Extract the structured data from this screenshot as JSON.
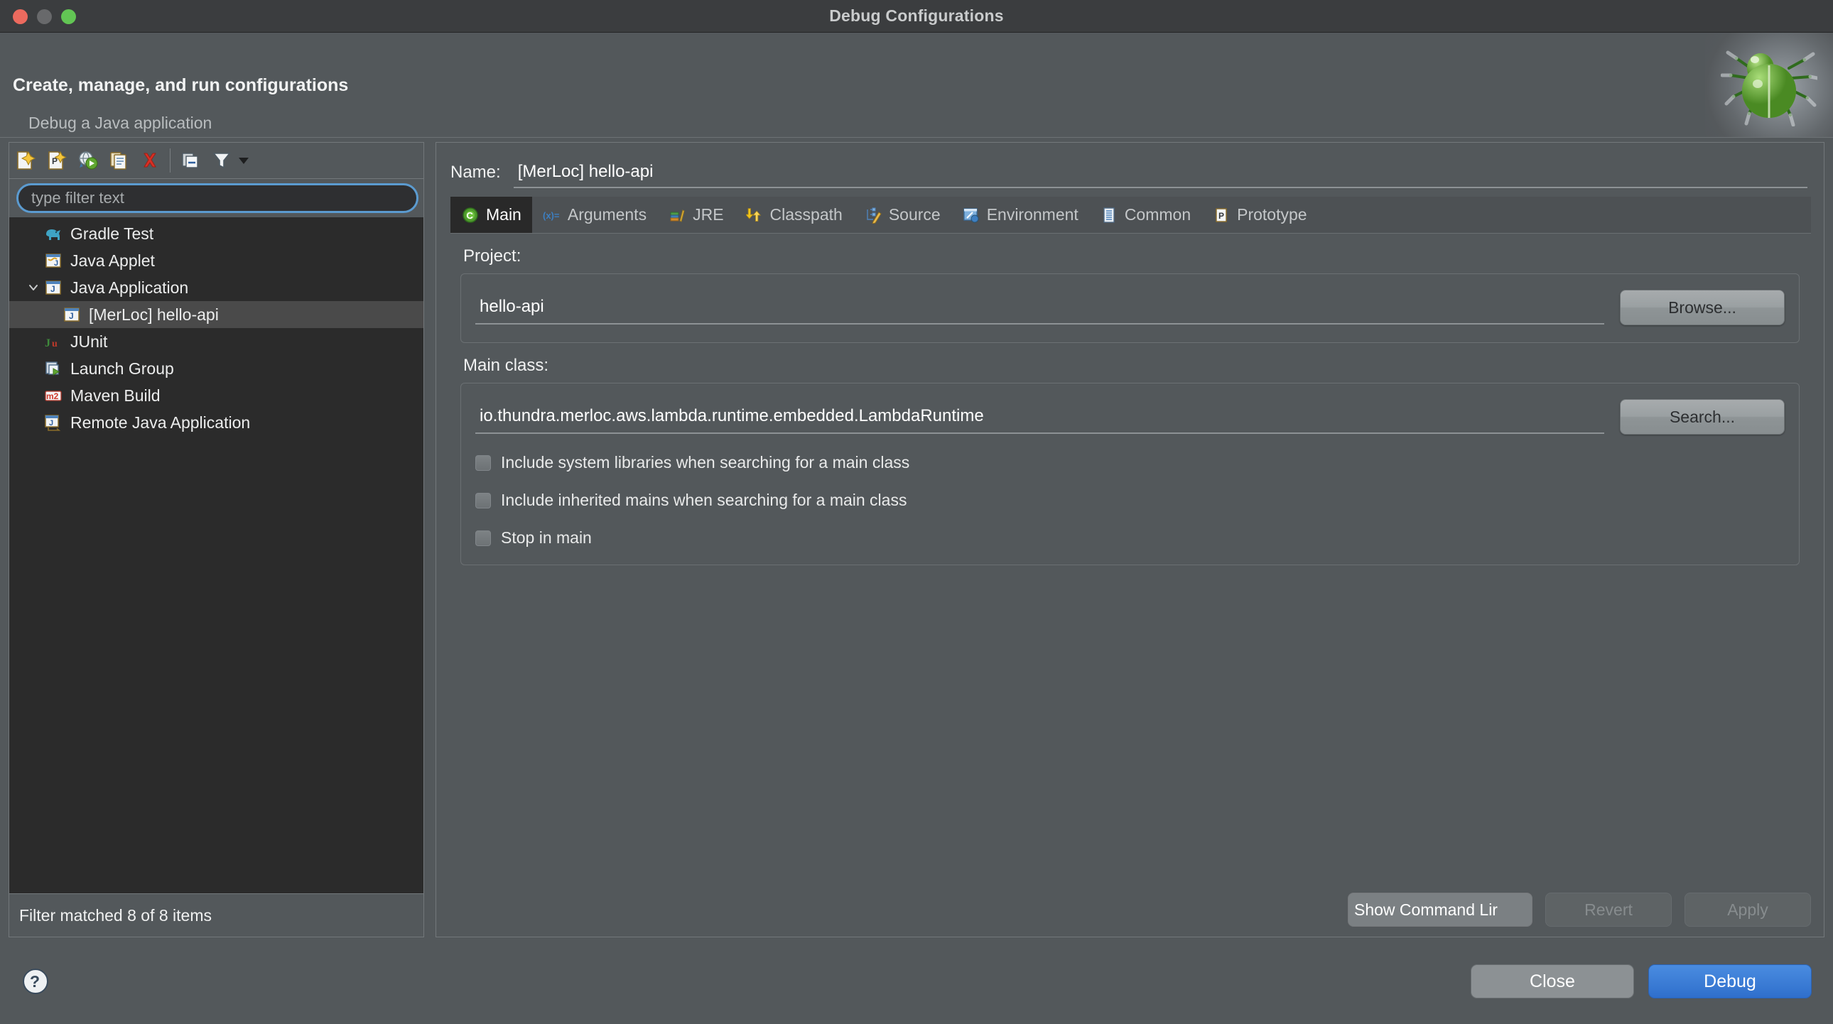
{
  "window": {
    "title": "Debug Configurations",
    "traffic_lights": [
      "close",
      "minimize",
      "maximize"
    ]
  },
  "header": {
    "title": "Create, manage, and run configurations",
    "subtitle": "Debug a Java application",
    "banner_icon": "green-bug-icon"
  },
  "left_panel": {
    "toolbar": [
      {
        "name": "new-launch-configuration",
        "icon": "new-config-icon"
      },
      {
        "name": "new-prototype",
        "icon": "new-prototype-icon"
      },
      {
        "name": "export",
        "icon": "export-run-icon"
      },
      {
        "name": "duplicate",
        "icon": "duplicate-icon"
      },
      {
        "name": "delete",
        "icon": "delete-red-x-icon"
      },
      {
        "name": "collapse-all",
        "icon": "collapse-all-icon"
      },
      {
        "name": "filter",
        "icon": "filter-funnel-icon"
      }
    ],
    "filter": {
      "placeholder": "type filter text",
      "value": ""
    },
    "tree": [
      {
        "label": "Gradle Test",
        "icon": "gradle-elephant-icon",
        "indent": 0,
        "expandable": false,
        "selected": false
      },
      {
        "label": "Java Applet",
        "icon": "java-applet-icon",
        "indent": 0,
        "expandable": false,
        "selected": false
      },
      {
        "label": "Java Application",
        "icon": "java-application-icon",
        "indent": 0,
        "expandable": true,
        "expanded": true,
        "selected": false
      },
      {
        "label": "[MerLoc] hello-api",
        "icon": "java-application-icon",
        "indent": 1,
        "expandable": false,
        "selected": true
      },
      {
        "label": "JUnit",
        "icon": "junit-icon",
        "indent": 0,
        "expandable": false,
        "selected": false
      },
      {
        "label": "Launch Group",
        "icon": "launch-group-icon",
        "indent": 0,
        "expandable": false,
        "selected": false
      },
      {
        "label": "Maven Build",
        "icon": "maven-m2-icon",
        "indent": 0,
        "expandable": false,
        "selected": false
      },
      {
        "label": "Remote Java Application",
        "icon": "remote-java-app-icon",
        "indent": 0,
        "expandable": false,
        "selected": false
      }
    ],
    "status": "Filter matched 8 of 8 items"
  },
  "right_panel": {
    "name_label": "Name:",
    "name_value": "[MerLoc] hello-api",
    "tabs": [
      {
        "label": "Main",
        "icon": "main-class-green-c-icon",
        "active": true
      },
      {
        "label": "Arguments",
        "icon": "arguments-xeq-icon",
        "active": false
      },
      {
        "label": "JRE",
        "icon": "jre-books-icon",
        "active": false
      },
      {
        "label": "Classpath",
        "icon": "classpath-arrows-icon",
        "active": false
      },
      {
        "label": "Source",
        "icon": "source-pencil-icon",
        "active": false
      },
      {
        "label": "Environment",
        "icon": "environment-icon",
        "active": false
      },
      {
        "label": "Common",
        "icon": "common-icon",
        "active": false
      },
      {
        "label": "Prototype",
        "icon": "prototype-p-icon",
        "active": false
      }
    ],
    "project": {
      "label": "Project:",
      "value": "hello-api",
      "browse_label": "Browse..."
    },
    "main_class": {
      "label": "Main class:",
      "value": "io.thundra.merloc.aws.lambda.runtime.embedded.LambdaRuntime",
      "search_label": "Search...",
      "checkboxes": [
        {
          "label": "Include system libraries when searching for a main class",
          "checked": false
        },
        {
          "label": "Include inherited mains when searching for a main class",
          "checked": false
        },
        {
          "label": "Stop in main",
          "checked": false
        }
      ]
    },
    "actions": {
      "show_command_line": "Show Command Lir",
      "revert": "Revert",
      "apply": "Apply",
      "revert_disabled": true,
      "apply_disabled": true
    }
  },
  "footer": {
    "help_icon": "help-question-icon",
    "close_label": "Close",
    "debug_label": "Debug"
  },
  "colors": {
    "window_bg": "#53585b",
    "titlebar_bg": "#3b3d3f",
    "tree_bg": "#2b2b2b",
    "tree_selected": "#4a4a4a",
    "tab_active_bg": "#292929",
    "accent_blue": "#2f6fcc",
    "focus_ring": "#5b9bd0",
    "delete_red": "#d93025",
    "bug_green": "#6aa832"
  }
}
